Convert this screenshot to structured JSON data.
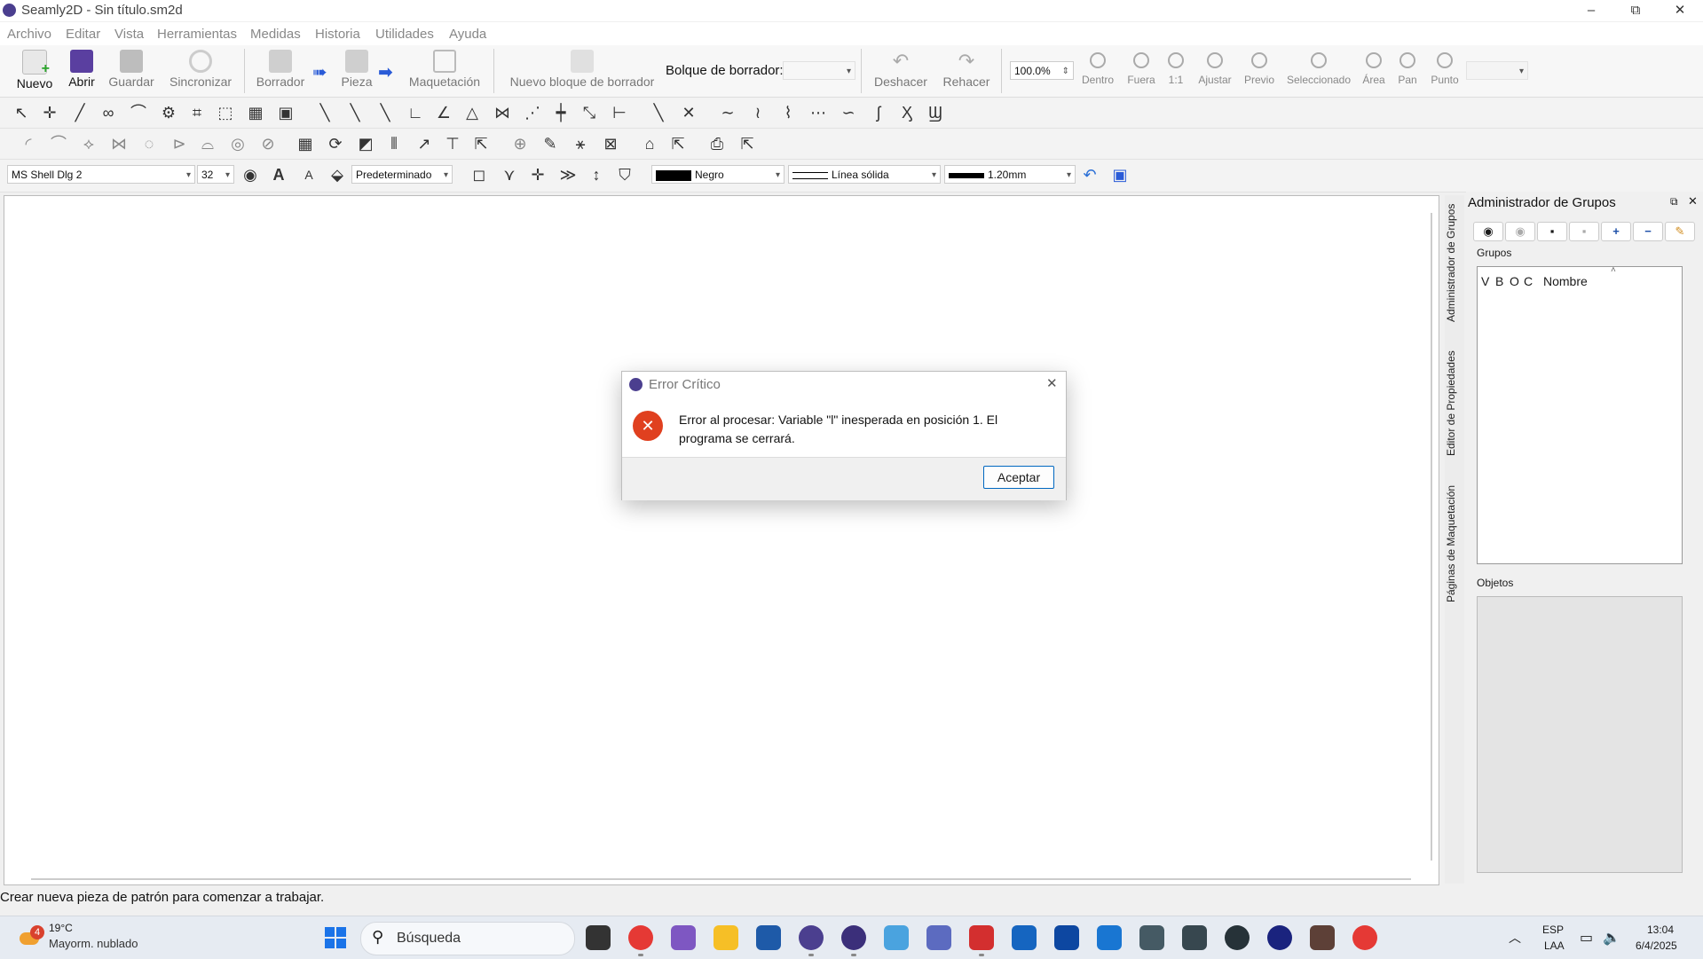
{
  "window": {
    "title": "Seamly2D - Sin título.sm2d",
    "minimize": "–",
    "maximize": "⧉",
    "close": "✕"
  },
  "menu": [
    "Archivo",
    "Editar",
    "Vista",
    "Herramientas",
    "Medidas",
    "Historia",
    "Utilidades",
    "Ayuda"
  ],
  "toolbar": {
    "nuevo": "Nuevo",
    "abrir": "Abrir",
    "guardar": "Guardar",
    "sincronizar": "Sincronizar",
    "borrador": "Borrador",
    "pieza": "Pieza",
    "maquetacion": "Maquetación",
    "nuevo_bloque": "Nuevo bloque de borrador",
    "bloque_label": "Bolque de borrador:",
    "bloque_value": "",
    "deshacer": "Deshacer",
    "rehacer": "Rehacer",
    "zoom_value": "100.0%",
    "zoom_buttons": [
      "Dentro",
      "Fuera",
      "1:1",
      "Ajustar",
      "Previo",
      "Seleccionado",
      "Área",
      "Pan",
      "Punto"
    ],
    "zoom_combo": ""
  },
  "propbar": {
    "font": "MS Shell Dlg 2",
    "size": "32",
    "text_style": "Predeterminado",
    "color": "Negro",
    "line_type": "Línea sólida",
    "line_weight": "1.20mm",
    "font_bigger": "A",
    "font_smaller": "A"
  },
  "sidetabs": [
    "Administrador de Grupos",
    "Editor de Propiedades",
    "Páginas de Maquetación"
  ],
  "panel": {
    "title": "Administrador de Grupos",
    "groups_label": "Grupos",
    "columns": [
      "V",
      "B",
      "O",
      "C",
      "Nombre"
    ],
    "objects_label": "Objetos",
    "sort_indicator": "˄"
  },
  "status": "Crear nueva pieza de patrón para comenzar a trabajar.",
  "dialog": {
    "title": "Error Crítico",
    "message_line1": "Error al procesar: Variable \"l\" inesperada en posición 1. El",
    "message_line2": "programa se cerrará.",
    "ok": "Aceptar",
    "close": "✕"
  },
  "taskbar": {
    "weather_temp": "19°C",
    "weather_desc": "Mayorm. nublado",
    "weather_badge": "4",
    "search": "Búsqueda",
    "lang1": "ESP",
    "lang2": "LAA",
    "time": "13:04",
    "date": "6/4/2025"
  },
  "colors": {
    "accent": "#0067c0",
    "error": "#e0401f",
    "app": "#4b3f8f"
  }
}
